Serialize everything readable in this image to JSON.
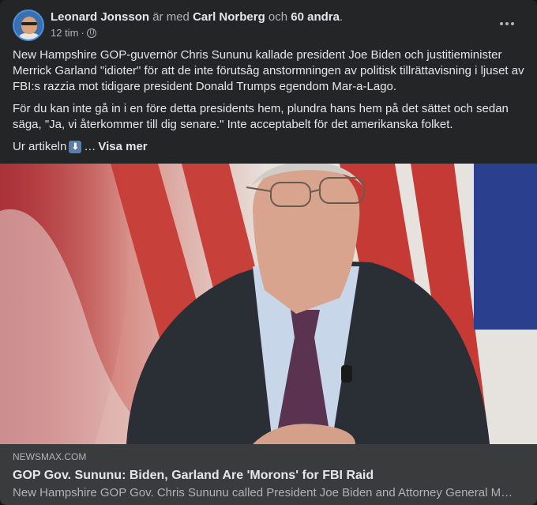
{
  "post": {
    "author": "Leonard Jonsson",
    "with_text": " är med ",
    "tagged_person": "Carl Norberg",
    "and_text": " och ",
    "others": "60 andra",
    "period": ".",
    "timestamp": "12 tim",
    "dot": "·",
    "privacy_icon": "globe-icon",
    "paragraph1": "New Hampshire GOP-guvernör Chris Sununu kallade president Joe Biden och justitieminister Merrick Garland \"idioter\" för att de inte förutsåg anstormningen av politisk tillrättavisning i ljuset av FBI:s razzia mot tidigare president Donald Trumps egendom Mar-a-Lago.",
    "paragraph2": "För du kan inte gå in i en före detta presidents hem, plundra hans hem på det sättet och sedan säga, \"Ja, vi återkommer till dig senare.\" Inte acceptabelt för det amerikanska folket.",
    "source_prefix": "Ur artikeln",
    "down_arrow_emoji": "⬇",
    "ellipsis": "…",
    "see_more": "Visa mer"
  },
  "link": {
    "domain": "NEWSMAX.COM",
    "headline": "GOP Gov. Sununu: Biden, Garland Are 'Morons' for FBI Raid",
    "description": "New Hampshire GOP Gov. Chris Sununu called President Joe Biden and Attorney General M…"
  },
  "colors": {
    "card_bg": "#242526",
    "preview_bg": "#3a3b3c",
    "primary_text": "#e4e6eb",
    "secondary_text": "#b0b3b8"
  }
}
